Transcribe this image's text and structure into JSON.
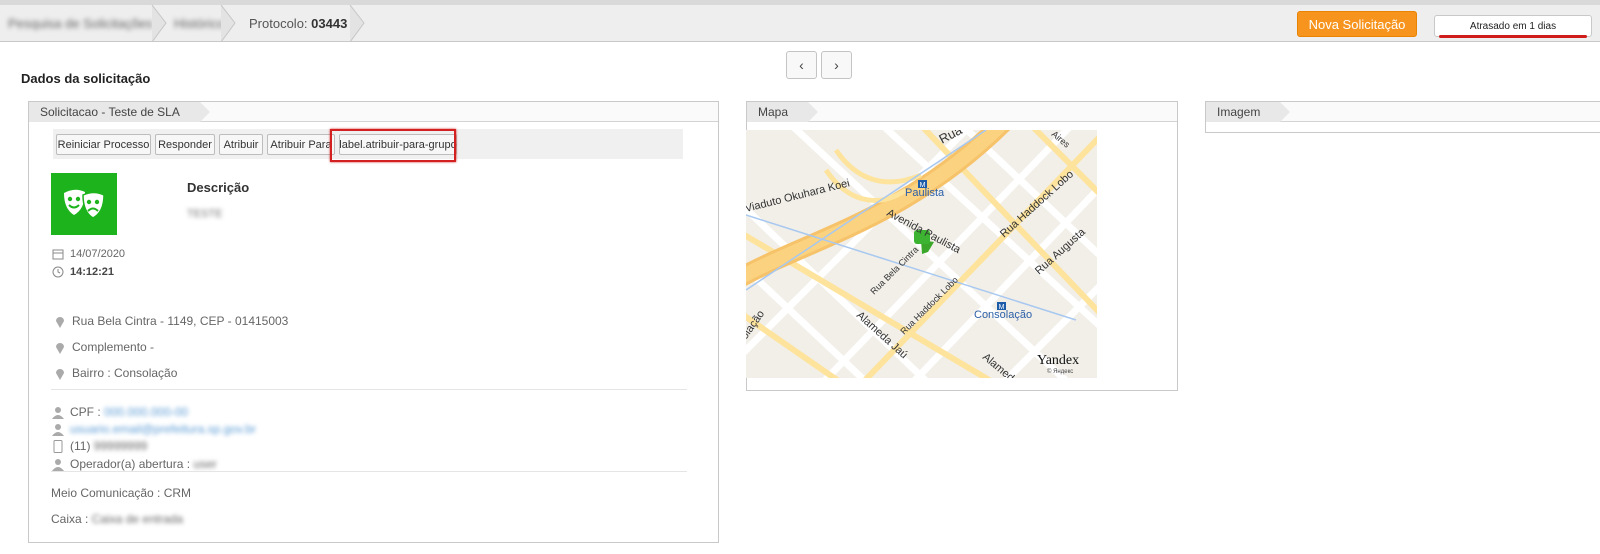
{
  "breadcrumb": {
    "item1": "Pesquisa de Solicitações",
    "item2": "Histórico",
    "protocol_label": "Protocolo:",
    "protocol_number": "03443"
  },
  "header": {
    "new_button": "Nova Solicitação",
    "late_status": "Atrasado em 1 dias"
  },
  "pager": {
    "prev": "‹",
    "next": "›"
  },
  "page_title": "Dados da solicitação",
  "request_panel": {
    "tab": "Solicitacao - Teste de SLA",
    "actions": [
      "Reiniciar Processo",
      "Responder",
      "Atribuir",
      "Atribuir Para",
      "label.atribuir-para-grupo"
    ],
    "description_label": "Descrição",
    "description_value": "TESTE",
    "date": "14/07/2020",
    "time": "14:12:21",
    "address": "Rua Bela Cintra - 1149, CEP - 01415003",
    "complement": "Complemento -",
    "neighborhood": "Bairro : Consolação",
    "cpf_label": "CPF :",
    "cpf_value": "000.000.000-00",
    "email": "usuario.email@prefeitura.sp.gov.br",
    "phone_prefix": "(11)",
    "phone_value": "99999999",
    "operator_label": "Operador(a) abertura :",
    "operator_value": "user",
    "channel": "Meio Comunicação : CRM",
    "box_label": "Caixa :",
    "box_value": "Caixa de entrada"
  },
  "map_panel": {
    "tab": "Mapa",
    "labels": {
      "paulista": "Paulista",
      "consolacao": "Consolação",
      "viaduto": "Viaduto Okuhara Koei",
      "avenida": "Avenida Paulista",
      "haddock1": "Rua Haddock Lobo",
      "haddock2": "Rua Haddock Lobo",
      "augusta": "Rua Augusta",
      "bela": "Rua Bela Cintra",
      "jau": "Alameda Jaú",
      "rua": "Rua",
      "alam": "Alameda",
      "alac": "olação",
      "aires": "Aires",
      "brand": "Yandex",
      "brand_sub": "© Яндекс"
    }
  },
  "image_panel": {
    "tab": "Imagem"
  },
  "colors": {
    "accent": "#f7941d",
    "avatar": "#1cb31c",
    "late_bar": "#d01b1b"
  }
}
